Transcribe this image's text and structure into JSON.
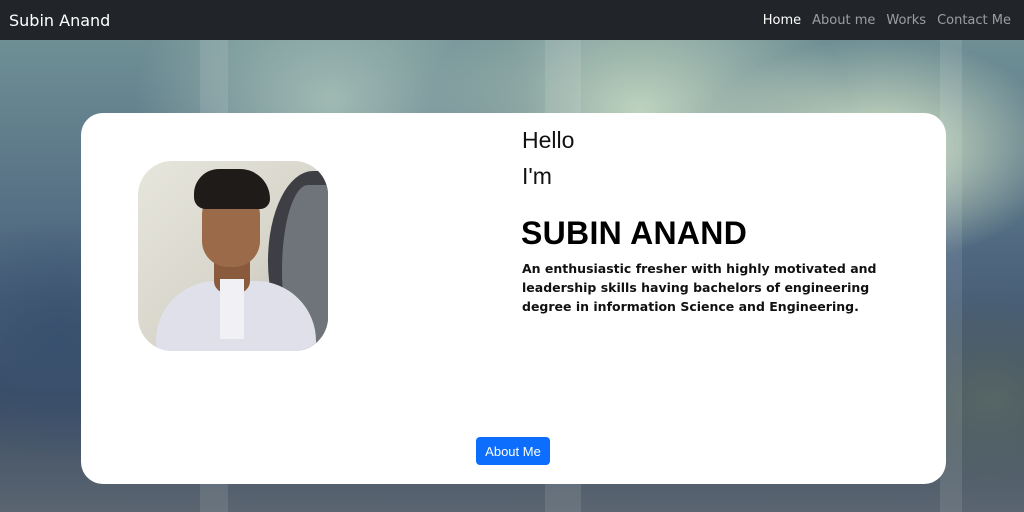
{
  "navbar": {
    "brand": "Subin Anand",
    "links": [
      "Home",
      "About me",
      "Works",
      "Contact Me"
    ],
    "active": "Home"
  },
  "hero": {
    "greeting": "Hello",
    "intro": "I'm",
    "name": "SUBIN ANAND",
    "description": "An enthusiastic fresher with highly motivated and leadership skills having bachelors of engineering degree in information Science and Engineering.",
    "button_label": "About Me"
  },
  "colors": {
    "navbar_bg": "#212529",
    "primary_button": "#0d6efd",
    "card_bg": "#ffffff"
  }
}
